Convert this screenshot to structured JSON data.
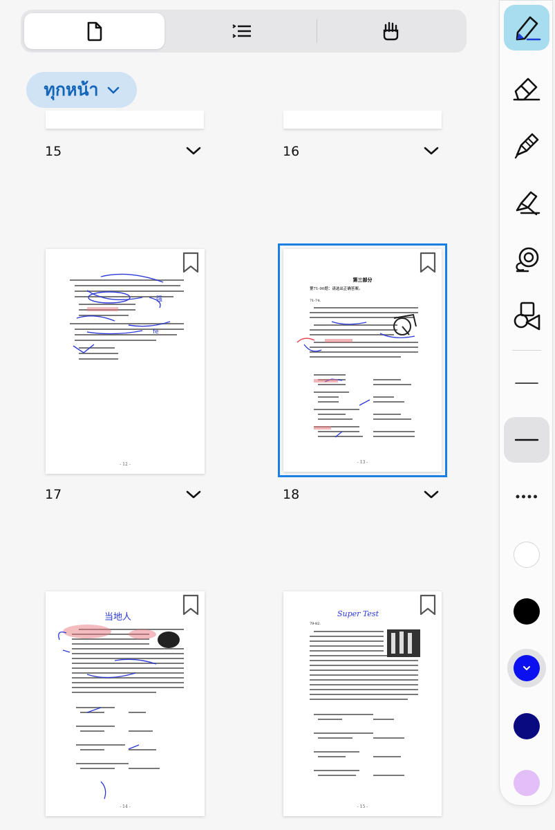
{
  "view_tabs": [
    {
      "icon": "page-icon",
      "active": true
    },
    {
      "icon": "outline-list-icon",
      "active": false
    },
    {
      "icon": "hand-icon",
      "active": false
    }
  ],
  "filter": {
    "label": "ทุกหน้า",
    "icon": "chevron-down-icon"
  },
  "pages_row_top": [
    {
      "number": "15"
    },
    {
      "number": "16"
    }
  ],
  "pages": [
    {
      "number": "17",
      "footer": "- 12 -",
      "selected": false
    },
    {
      "number": "18",
      "footer": "- 13 -",
      "selected": true,
      "heading": "第三部分",
      "instruction": "第71-90题：请选出正确答案。",
      "range": "71-74."
    },
    {
      "number": "",
      "footer": "- 14 -",
      "handwritten": "当地人",
      "selected": false
    },
    {
      "number": "",
      "footer": "- 15 -",
      "handwritten": "Super Test",
      "range": "79-82.",
      "selected": false
    }
  ],
  "toolbar": {
    "tools": [
      "pen-icon",
      "eraser-icon",
      "pencil-icon",
      "highlighter-icon",
      "lasso-icon",
      "shapes-icon"
    ],
    "strokes": [
      "thin-stroke-icon",
      "medium-stroke-icon"
    ],
    "more": "more-icon",
    "colors": [
      "#ffffff",
      "#000000",
      "#0a10f0",
      "#0a0a80",
      "#e3bff7"
    ],
    "accent": "#1a7fe5"
  }
}
